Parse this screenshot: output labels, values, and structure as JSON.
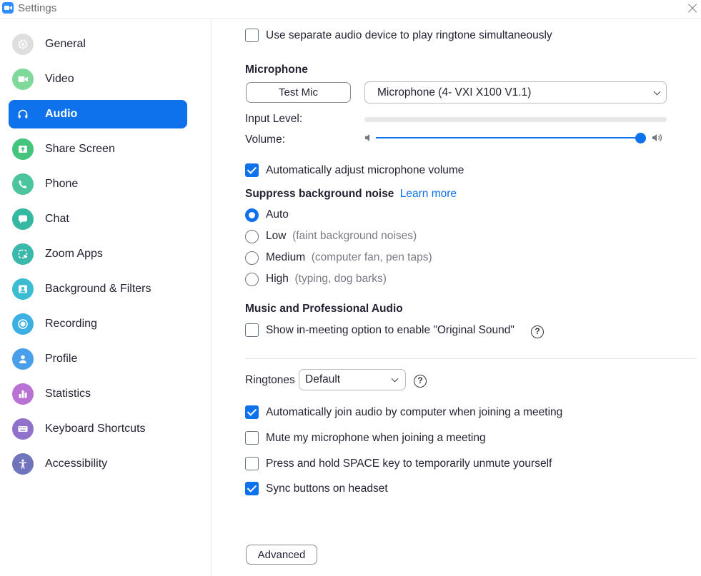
{
  "window": {
    "title": "Settings"
  },
  "sidebar": {
    "items": [
      {
        "label": "General",
        "icon": "gear-icon",
        "color": "#d9d9d9",
        "active": false
      },
      {
        "label": "Video",
        "icon": "video-camera-icon",
        "color": "#5ccc7a",
        "active": false
      },
      {
        "label": "Audio",
        "icon": "headphones-icon",
        "color": "#0e72ed",
        "active": true
      },
      {
        "label": "Share Screen",
        "icon": "share-screen-icon",
        "color": "#3fbf7a",
        "active": false
      },
      {
        "label": "Phone",
        "icon": "phone-icon",
        "color": "#3fbf9a",
        "active": false
      },
      {
        "label": "Chat",
        "icon": "chat-icon",
        "color": "#2fb5a0",
        "active": false
      },
      {
        "label": "Zoom Apps",
        "icon": "zoom-apps-icon",
        "color": "#2fb5a8",
        "active": false
      },
      {
        "label": "Background & Filters",
        "icon": "background-icon",
        "color": "#35b8d0",
        "active": false
      },
      {
        "label": "Recording",
        "icon": "record-icon",
        "color": "#35aee0",
        "active": false
      },
      {
        "label": "Profile",
        "icon": "profile-icon",
        "color": "#3a9be8",
        "active": false
      },
      {
        "label": "Statistics",
        "icon": "statistics-icon",
        "color": "#b06ad0",
        "active": false
      },
      {
        "label": "Keyboard Shortcuts",
        "icon": "keyboard-icon",
        "color": "#8a68c8",
        "active": false
      },
      {
        "label": "Accessibility",
        "icon": "accessibility-icon",
        "color": "#6a6fb8",
        "active": false
      }
    ]
  },
  "audio": {
    "separate_ringtone": {
      "label": "Use separate audio device to play ringtone simultaneously",
      "checked": false
    },
    "microphone": {
      "heading": "Microphone",
      "test_button": "Test Mic",
      "device": "Microphone (4- VXI X100 V1.1)",
      "input_level_label": "Input Level:",
      "volume_label": "Volume:",
      "volume_level": 1.0
    },
    "auto_adjust": {
      "label": "Automatically adjust microphone volume",
      "checked": true
    },
    "suppress": {
      "heading": "Suppress background noise",
      "learn_more": "Learn more",
      "options": [
        {
          "label": "Auto",
          "hint": "",
          "checked": true
        },
        {
          "label": "Low",
          "hint": "(faint background noises)",
          "checked": false
        },
        {
          "label": "Medium",
          "hint": "(computer fan, pen taps)",
          "checked": false
        },
        {
          "label": "High",
          "hint": "(typing, dog barks)",
          "checked": false
        }
      ]
    },
    "music": {
      "heading": "Music and Professional Audio",
      "original_sound": {
        "label": "Show in-meeting option to enable \"Original Sound\"",
        "checked": false
      }
    },
    "ringtones": {
      "label": "Ringtones",
      "value": "Default"
    },
    "options": [
      {
        "label": "Automatically join audio by computer when joining a meeting",
        "checked": true
      },
      {
        "label": "Mute my microphone when joining a meeting",
        "checked": false
      },
      {
        "label": "Press and hold SPACE key to temporarily unmute yourself",
        "checked": false
      },
      {
        "label": "Sync buttons on headset",
        "checked": true
      }
    ],
    "advanced_button": "Advanced"
  },
  "colors": {
    "accent": "#0e72ed",
    "text": "#232333",
    "hint": "#7a7a86"
  }
}
